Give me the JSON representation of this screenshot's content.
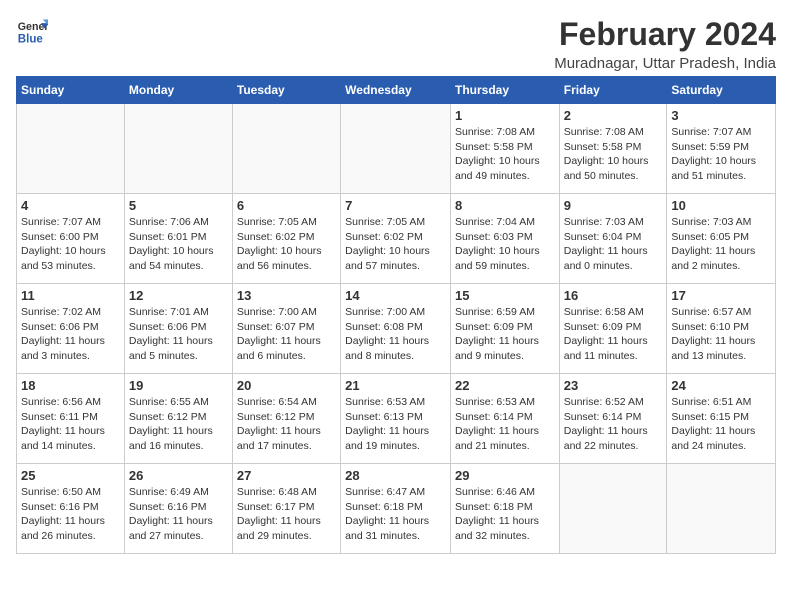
{
  "header": {
    "logo_line1": "General",
    "logo_line2": "Blue",
    "month_year": "February 2024",
    "location": "Muradnagar, Uttar Pradesh, India"
  },
  "days_of_week": [
    "Sunday",
    "Monday",
    "Tuesday",
    "Wednesday",
    "Thursday",
    "Friday",
    "Saturday"
  ],
  "weeks": [
    [
      {
        "day": "",
        "info": ""
      },
      {
        "day": "",
        "info": ""
      },
      {
        "day": "",
        "info": ""
      },
      {
        "day": "",
        "info": ""
      },
      {
        "day": "1",
        "info": "Sunrise: 7:08 AM\nSunset: 5:58 PM\nDaylight: 10 hours\nand 49 minutes."
      },
      {
        "day": "2",
        "info": "Sunrise: 7:08 AM\nSunset: 5:58 PM\nDaylight: 10 hours\nand 50 minutes."
      },
      {
        "day": "3",
        "info": "Sunrise: 7:07 AM\nSunset: 5:59 PM\nDaylight: 10 hours\nand 51 minutes."
      }
    ],
    [
      {
        "day": "4",
        "info": "Sunrise: 7:07 AM\nSunset: 6:00 PM\nDaylight: 10 hours\nand 53 minutes."
      },
      {
        "day": "5",
        "info": "Sunrise: 7:06 AM\nSunset: 6:01 PM\nDaylight: 10 hours\nand 54 minutes."
      },
      {
        "day": "6",
        "info": "Sunrise: 7:05 AM\nSunset: 6:02 PM\nDaylight: 10 hours\nand 56 minutes."
      },
      {
        "day": "7",
        "info": "Sunrise: 7:05 AM\nSunset: 6:02 PM\nDaylight: 10 hours\nand 57 minutes."
      },
      {
        "day": "8",
        "info": "Sunrise: 7:04 AM\nSunset: 6:03 PM\nDaylight: 10 hours\nand 59 minutes."
      },
      {
        "day": "9",
        "info": "Sunrise: 7:03 AM\nSunset: 6:04 PM\nDaylight: 11 hours\nand 0 minutes."
      },
      {
        "day": "10",
        "info": "Sunrise: 7:03 AM\nSunset: 6:05 PM\nDaylight: 11 hours\nand 2 minutes."
      }
    ],
    [
      {
        "day": "11",
        "info": "Sunrise: 7:02 AM\nSunset: 6:06 PM\nDaylight: 11 hours\nand 3 minutes."
      },
      {
        "day": "12",
        "info": "Sunrise: 7:01 AM\nSunset: 6:06 PM\nDaylight: 11 hours\nand 5 minutes."
      },
      {
        "day": "13",
        "info": "Sunrise: 7:00 AM\nSunset: 6:07 PM\nDaylight: 11 hours\nand 6 minutes."
      },
      {
        "day": "14",
        "info": "Sunrise: 7:00 AM\nSunset: 6:08 PM\nDaylight: 11 hours\nand 8 minutes."
      },
      {
        "day": "15",
        "info": "Sunrise: 6:59 AM\nSunset: 6:09 PM\nDaylight: 11 hours\nand 9 minutes."
      },
      {
        "day": "16",
        "info": "Sunrise: 6:58 AM\nSunset: 6:09 PM\nDaylight: 11 hours\nand 11 minutes."
      },
      {
        "day": "17",
        "info": "Sunrise: 6:57 AM\nSunset: 6:10 PM\nDaylight: 11 hours\nand 13 minutes."
      }
    ],
    [
      {
        "day": "18",
        "info": "Sunrise: 6:56 AM\nSunset: 6:11 PM\nDaylight: 11 hours\nand 14 minutes."
      },
      {
        "day": "19",
        "info": "Sunrise: 6:55 AM\nSunset: 6:12 PM\nDaylight: 11 hours\nand 16 minutes."
      },
      {
        "day": "20",
        "info": "Sunrise: 6:54 AM\nSunset: 6:12 PM\nDaylight: 11 hours\nand 17 minutes."
      },
      {
        "day": "21",
        "info": "Sunrise: 6:53 AM\nSunset: 6:13 PM\nDaylight: 11 hours\nand 19 minutes."
      },
      {
        "day": "22",
        "info": "Sunrise: 6:53 AM\nSunset: 6:14 PM\nDaylight: 11 hours\nand 21 minutes."
      },
      {
        "day": "23",
        "info": "Sunrise: 6:52 AM\nSunset: 6:14 PM\nDaylight: 11 hours\nand 22 minutes."
      },
      {
        "day": "24",
        "info": "Sunrise: 6:51 AM\nSunset: 6:15 PM\nDaylight: 11 hours\nand 24 minutes."
      }
    ],
    [
      {
        "day": "25",
        "info": "Sunrise: 6:50 AM\nSunset: 6:16 PM\nDaylight: 11 hours\nand 26 minutes."
      },
      {
        "day": "26",
        "info": "Sunrise: 6:49 AM\nSunset: 6:16 PM\nDaylight: 11 hours\nand 27 minutes."
      },
      {
        "day": "27",
        "info": "Sunrise: 6:48 AM\nSunset: 6:17 PM\nDaylight: 11 hours\nand 29 minutes."
      },
      {
        "day": "28",
        "info": "Sunrise: 6:47 AM\nSunset: 6:18 PM\nDaylight: 11 hours\nand 31 minutes."
      },
      {
        "day": "29",
        "info": "Sunrise: 6:46 AM\nSunset: 6:18 PM\nDaylight: 11 hours\nand 32 minutes."
      },
      {
        "day": "",
        "info": ""
      },
      {
        "day": "",
        "info": ""
      }
    ]
  ]
}
